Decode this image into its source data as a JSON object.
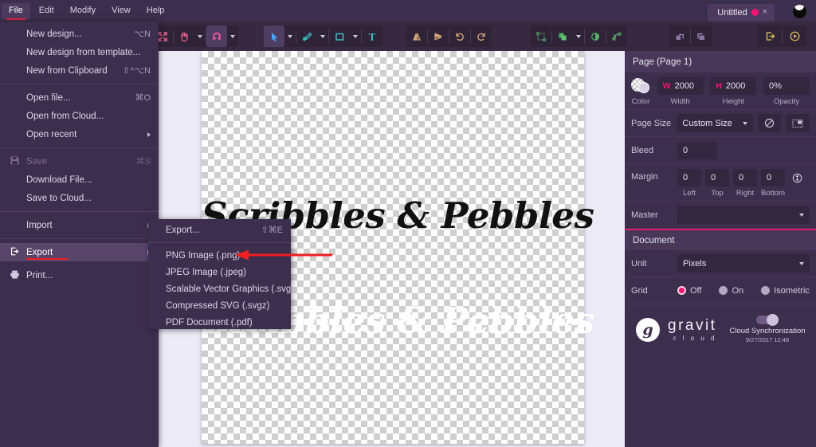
{
  "menubar": {
    "items": [
      {
        "label": "File",
        "active": true
      },
      {
        "label": "Edit",
        "active": false
      },
      {
        "label": "Modify",
        "active": false
      },
      {
        "label": "View",
        "active": false
      },
      {
        "label": "Help",
        "active": false
      }
    ]
  },
  "tab": {
    "title": "Untitled",
    "close": "×"
  },
  "file_menu": {
    "items": [
      {
        "label": "New design...",
        "shortcut": "⌥N"
      },
      {
        "label": "New design from template...",
        "shortcut": ""
      },
      {
        "label": "New from Clipboard",
        "shortcut": "⇧^⌥N"
      },
      {
        "label": "Open file...",
        "shortcut": "⌘O"
      },
      {
        "label": "Open from Cloud...",
        "shortcut": ""
      },
      {
        "label": "Open recent",
        "shortcut": ""
      },
      {
        "label": "Save",
        "shortcut": "⌘S"
      },
      {
        "label": "Download File...",
        "shortcut": ""
      },
      {
        "label": "Save to Cloud...",
        "shortcut": ""
      },
      {
        "label": "Import",
        "shortcut": ""
      },
      {
        "label": "Export",
        "shortcut": ""
      },
      {
        "label": "Print...",
        "shortcut": ""
      }
    ]
  },
  "export_submenu": {
    "items": [
      {
        "label": "Export...",
        "shortcut": "⇧⌘E"
      },
      {
        "label": "PNG Image (.png)",
        "shortcut": ""
      },
      {
        "label": "JPEG Image (.jpeg)",
        "shortcut": ""
      },
      {
        "label": "Scalable Vector Graphics (.svg)",
        "shortcut": ""
      },
      {
        "label": "Compressed SVG (.svgz)",
        "shortcut": ""
      },
      {
        "label": "PDF Document (.pdf)",
        "shortcut": ""
      }
    ]
  },
  "canvas": {
    "text_dark": "Scribbles & Pebbles",
    "text_light": "Scribbles & Pebbles"
  },
  "page_panel": {
    "title": "Page (Page 1)",
    "color_caption": "Color",
    "width_prefix": "W",
    "width_value": "2000",
    "width_caption": "Width",
    "height_prefix": "H",
    "height_value": "2000",
    "height_caption": "Height",
    "opacity_value": "0%",
    "opacity_caption": "Opacity",
    "page_size_label": "Page Size",
    "page_size_value": "Custom Size",
    "bleed_label": "Bleed",
    "bleed_value": "0",
    "margin_label": "Margin",
    "margin_left": "0",
    "margin_top": "0",
    "margin_right": "0",
    "margin_bottom": "0",
    "cap_left": "Left",
    "cap_top": "Top",
    "cap_right": "Right",
    "cap_bottom": "Bottom",
    "master_label": "Master",
    "master_value": ""
  },
  "document_panel": {
    "title": "Document",
    "unit_label": "Unit",
    "unit_value": "Pixels",
    "grid_label": "Grid",
    "grid_options": [
      {
        "label": "Off",
        "selected": true
      },
      {
        "label": "On",
        "selected": false
      },
      {
        "label": "Isometric",
        "selected": false
      }
    ]
  },
  "cloud": {
    "brand": "gravit",
    "brand_sub": "c l o u d",
    "sync_label": "Cloud Synchronization",
    "sync_date": "9/27/2017 12:48"
  },
  "toolbar": {
    "left_group": [
      "fit-screen-icon",
      "hand-icon",
      "snap-magnet-icon"
    ],
    "tool_group": [
      "pointer-icon",
      "pen-icon",
      "rectangle-icon",
      "text-icon"
    ],
    "transform_group": [
      "flip-horizontal-icon",
      "flip-vertical-icon",
      "rotate-ccw-icon",
      "rotate-cw-icon"
    ],
    "path_group": [
      "transform-icon",
      "boolean-union-icon",
      "mask-icon",
      "path-edit-icon"
    ],
    "arrange_group": [
      "bring-forward-icon",
      "send-backward-icon"
    ],
    "right_group": [
      "export-icon",
      "preview-icon"
    ]
  },
  "colors": {
    "panel_bg": "#3c2f4d",
    "toolbar_bg": "#37293f",
    "accent_pink": "#f0156f",
    "accent_red": "#ef1f1f",
    "canvas_bg": "#eceaf5"
  }
}
